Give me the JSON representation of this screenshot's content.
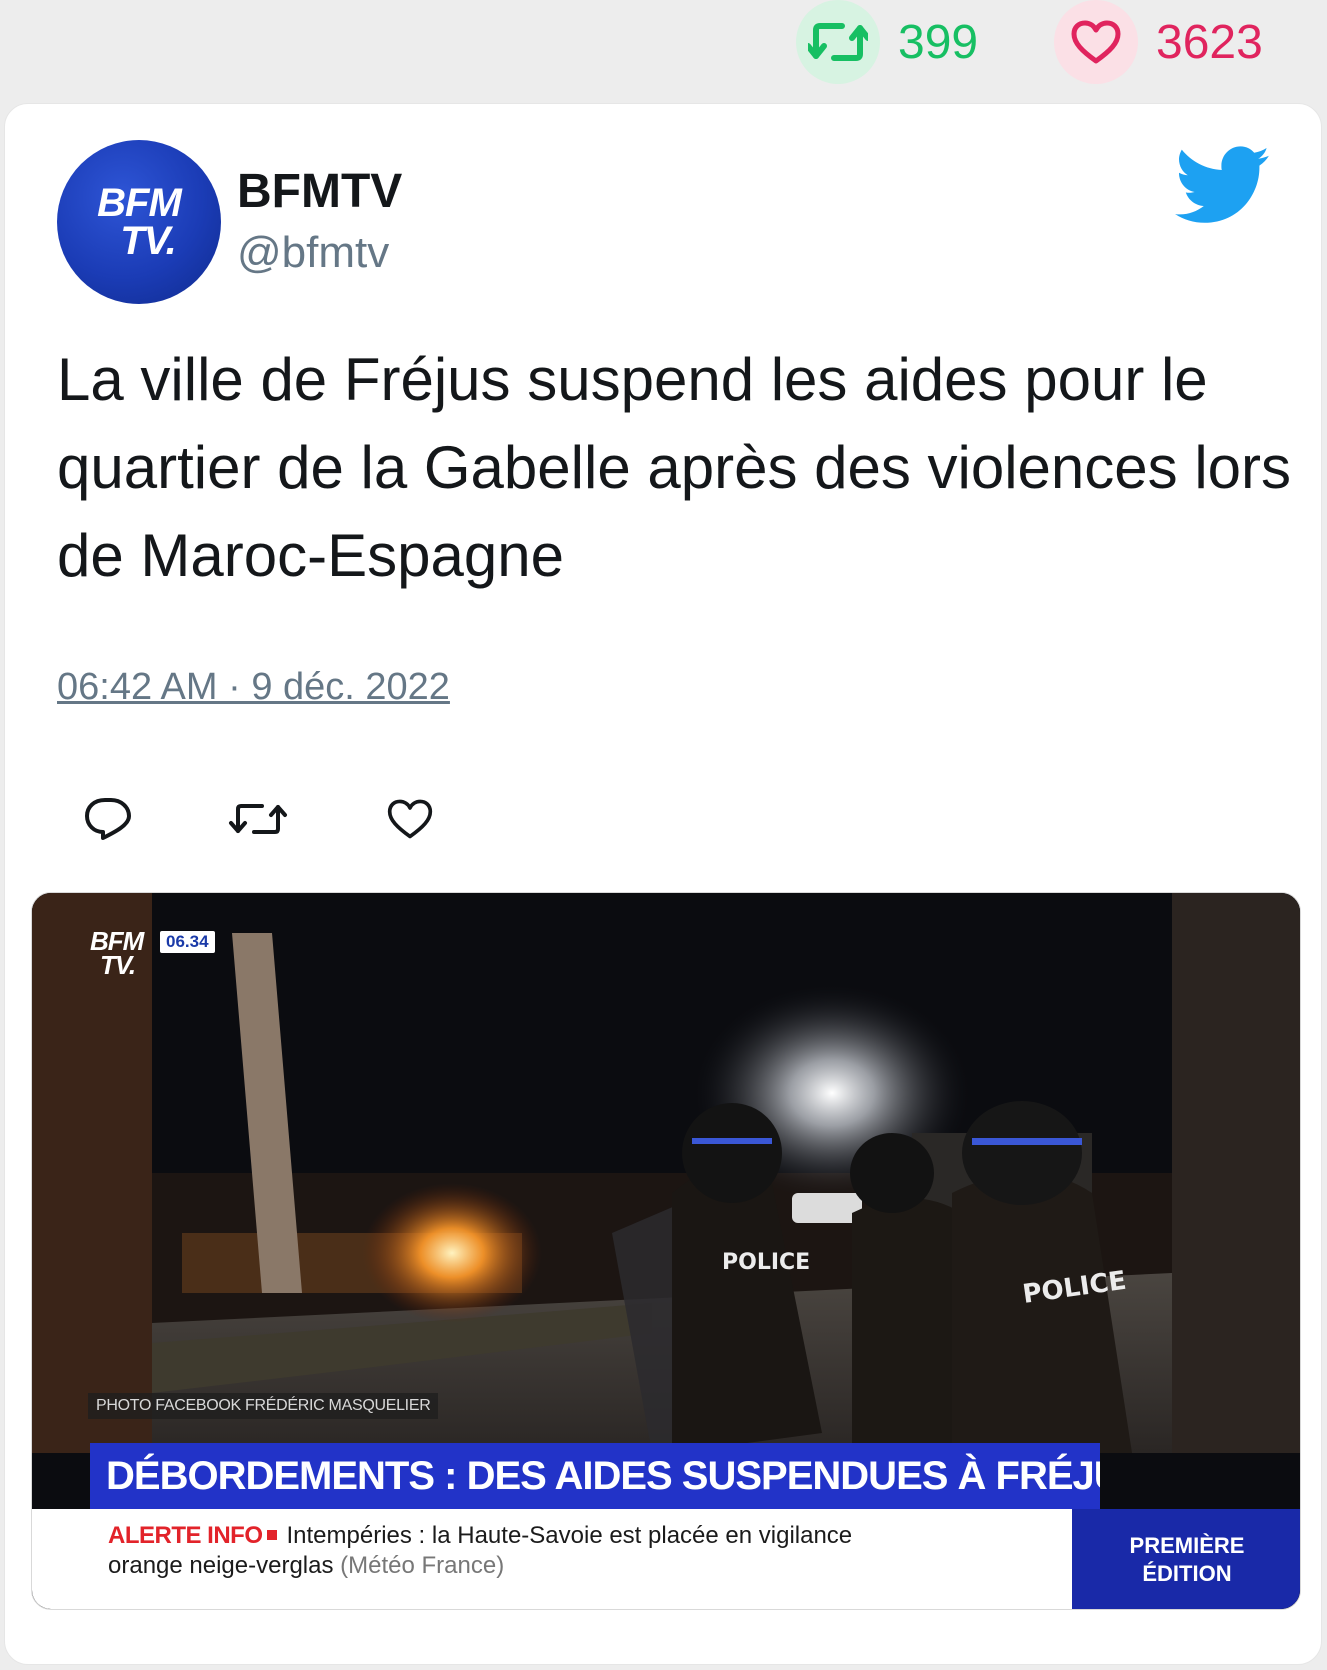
{
  "stats": {
    "retweet_icon": "retweet-icon",
    "retweets": "399",
    "like_icon": "heart-icon",
    "likes": "3623"
  },
  "tweet": {
    "avatar": {
      "line1": "BFM",
      "line2": "TV."
    },
    "display_name": "BFMTV",
    "handle": "@bfmtv",
    "brand_icon": "twitter-bird-icon",
    "text": "La ville de Fréjus suspend les aides pour le quartier de la Gabelle après des violences lors de Maroc-Espagne",
    "timestamp": "06:42 AM · 9 déc. 2022",
    "actions": [
      "reply-icon",
      "retweet-icon",
      "like-icon"
    ]
  },
  "media": {
    "channel_logo": {
      "line1": "BFM",
      "line2": "TV."
    },
    "clock": "06.34",
    "photo_credit": "PHOTO FACEBOOK FRÉDÉRIC MASQUELIER",
    "police_label": "POLICE",
    "headline": "DÉBORDEMENTS : DES AIDES SUSPENDUES À FRÉJUS",
    "ticker": {
      "label": "ALERTE INFO",
      "line1": "Intempéries : la Haute-Savoie est placée en vigilance",
      "line2": "orange neige-verglas",
      "source": "(Météo France)"
    },
    "edition": {
      "line1": "PREMIÈRE",
      "line2": "ÉDITION"
    }
  },
  "colors": {
    "retweet_green": "#17bf63",
    "like_red": "#e0245e",
    "twitter_blue": "#1da1f2",
    "bfm_blue": "#2233c8",
    "alert_red": "#e2232a"
  }
}
